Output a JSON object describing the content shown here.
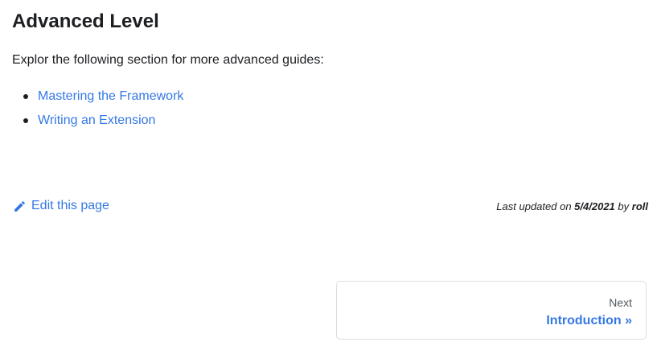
{
  "page": {
    "title": "Advanced Level",
    "intro": "Explor the following section for more advanced guides:"
  },
  "guides": {
    "items": [
      {
        "label": "Mastering the Framework"
      },
      {
        "label": "Writing an Extension"
      }
    ]
  },
  "footer": {
    "edit_label": "Edit this page",
    "edit_icon": "pencil-icon",
    "last_updated_prefix": "Last updated on",
    "last_updated_date": "5/4/2021",
    "last_updated_by": "by",
    "last_updated_author": "roll"
  },
  "pagination": {
    "next_sublabel": "Next",
    "next_title": "Introduction »"
  },
  "colors": {
    "link": "#3578e5",
    "text": "#1c1e21",
    "border": "#dadde1",
    "muted": "#525860"
  }
}
